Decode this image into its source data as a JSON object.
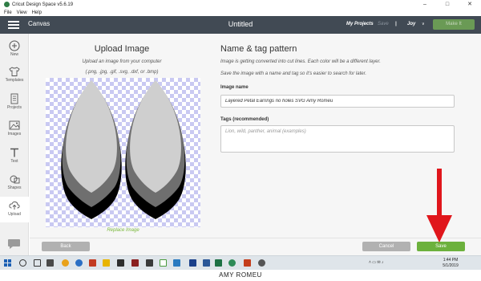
{
  "window": {
    "title": "Cricut Design Space  v5.6.19",
    "minimize": "–",
    "maximize": "□",
    "close": "✕"
  },
  "menu": [
    "File",
    "View",
    "Help"
  ],
  "header": {
    "section": "Canvas",
    "document_title": "Untitled",
    "my_projects": "My Projects",
    "save": "Save",
    "separator": "|",
    "user": "Joy",
    "user_caret": "∨",
    "make_it": "Make It"
  },
  "sidebar": [
    {
      "label": "New",
      "icon": "plus-icon"
    },
    {
      "label": "Templates",
      "icon": "shirt-icon"
    },
    {
      "label": "Projects",
      "icon": "projects-icon"
    },
    {
      "label": "Images",
      "icon": "image-icon"
    },
    {
      "label": "Text",
      "icon": "text-icon"
    },
    {
      "label": "Shapes",
      "icon": "shapes-icon"
    },
    {
      "label": "Upload",
      "icon": "upload-icon",
      "active": true
    }
  ],
  "upload": {
    "title": "Upload Image",
    "subtitle": "Upload an image from your computer",
    "formats": "(.png, .jpg, .gif, .svg, .dxf, or .bmp)",
    "replace_link": "Replace Image"
  },
  "form": {
    "title": "Name & tag pattern",
    "note1": "Image is getting converted into cut lines. Each color will be a different layer.",
    "note2": "Save the image with a name and tag so it's easier to search for later.",
    "name_label": "Image name",
    "name_value": "Layered Petal Earrings no holes SVG Amy Romeu",
    "tags_label": "Tags (recommended)",
    "tags_placeholder": "Lion, wild, panther, animal (examples)"
  },
  "buttons": {
    "back": "Back",
    "cancel": "Cancel",
    "save": "Save"
  },
  "taskbar": {
    "tray": "˄  ▭  ✉  ♪",
    "time": "1:44 PM",
    "date": "5/1/2019"
  },
  "watermark": "AMY ROMEU",
  "colors": {
    "header": "#414a54",
    "accent_green": "#6cb13d",
    "arrow_red": "#e0161c"
  }
}
